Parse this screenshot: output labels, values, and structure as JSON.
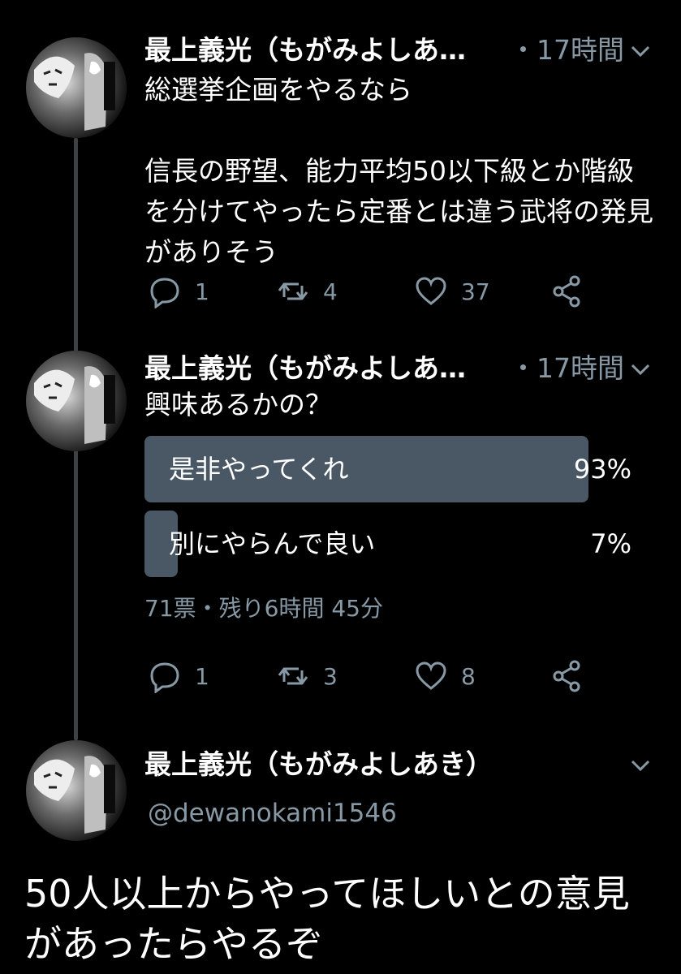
{
  "tweets": [
    {
      "name": "最上義光（もがみよしあ…",
      "time": "・17時間",
      "text": "総選挙企画をやるなら\n\n信長の野望、能力平均50以下級とか階級を分けてやったら定番とは違う武将の発見がありそう",
      "replies": "1",
      "retweets": "4",
      "likes": "37"
    },
    {
      "name": "最上義光（もがみよしあ…",
      "time": "・17時間",
      "text": "興味あるかの？",
      "poll": {
        "options": [
          {
            "label": "是非やってくれ",
            "pct": "93%",
            "value": 93
          },
          {
            "label": "別にやらんで良い",
            "pct": "7%",
            "value": 7
          }
        ],
        "meta": "71票・残り6時間 45分"
      },
      "replies": "1",
      "retweets": "3",
      "likes": "8"
    }
  ],
  "main_tweet": {
    "name": "最上義光（もがみよしあき）",
    "handle": "@dewanokami1546",
    "text": "50人以上からやってほしいとの意見があったらやるぞ"
  },
  "colors": {
    "background": "#000000",
    "secondary_text": "#8899a6",
    "poll_bar": "#4a5866"
  },
  "icons": [
    "reply-icon",
    "retweet-icon",
    "like-icon",
    "share-icon",
    "chevron-down-icon"
  ]
}
